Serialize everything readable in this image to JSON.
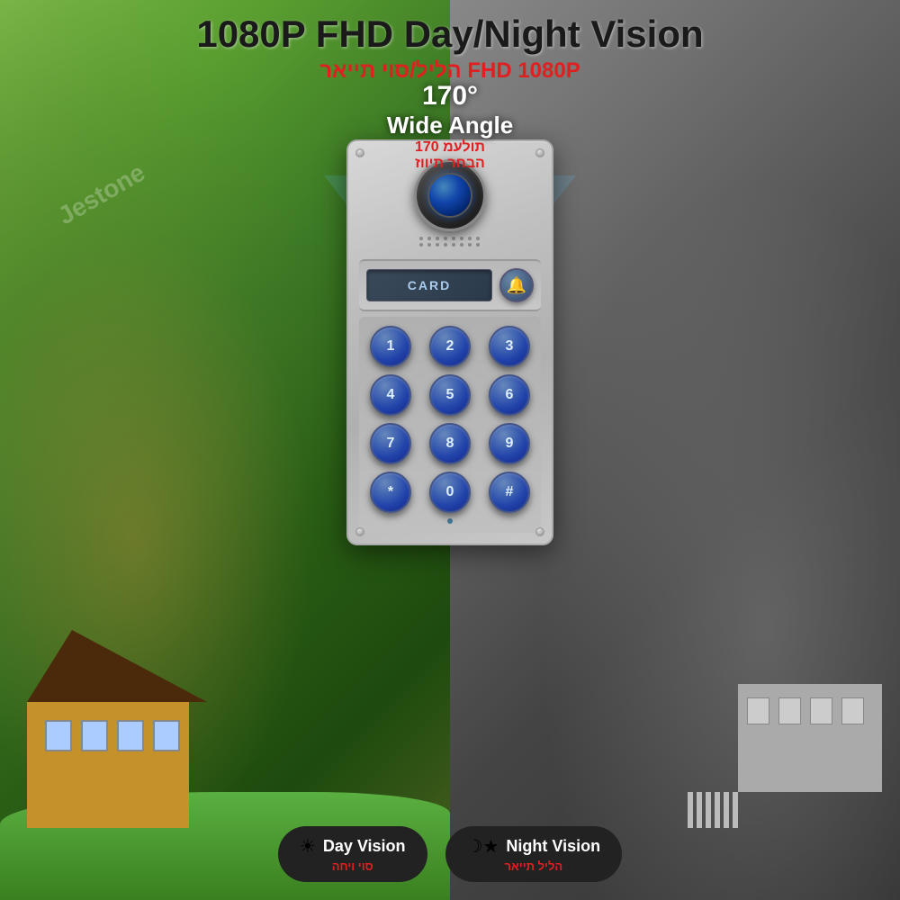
{
  "header": {
    "title_main": "1080P FHD Day/Night Vision",
    "title_hebrew": "הליל/סוי תייאר FHD 1080P"
  },
  "wide_angle": {
    "degrees": "170°",
    "label": "Wide Angle",
    "hebrew_line1": "תולעמ 170",
    "hebrew_line2": "הבחר תיווז"
  },
  "card_reader": {
    "label": "CARD"
  },
  "bell": {
    "icon": "🔔"
  },
  "keypad": {
    "keys": [
      "1",
      "2",
      "3",
      "4",
      "5",
      "6",
      "7",
      "8",
      "9",
      "*",
      "0",
      "#"
    ]
  },
  "badges": [
    {
      "icon": "☀",
      "label": "Day Vision",
      "hebrew": "סוי ויחה"
    },
    {
      "icon": "☽★",
      "label": "Night Vision",
      "hebrew": "הליל תייאר"
    }
  ],
  "watermark": "Jestone"
}
